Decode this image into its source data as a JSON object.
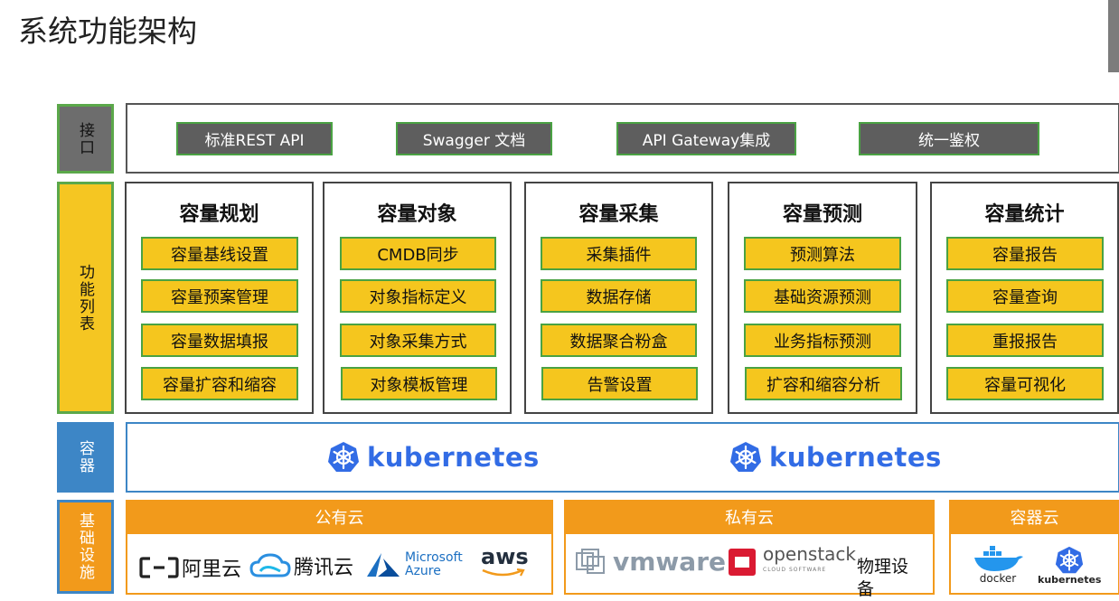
{
  "title": "系统功能架构",
  "rows": {
    "api": "接口",
    "functions": "功能列表",
    "container": "容器",
    "infra": "基础设施"
  },
  "api_buttons": [
    "标准REST API",
    "Swagger 文档",
    "API Gateway集成",
    "统一鉴权"
  ],
  "columns": [
    {
      "title": "容量规划",
      "items": [
        "容量基线设置",
        "容量预案管理",
        "容量数据填报",
        "容量扩容和缩容"
      ]
    },
    {
      "title": "容量对象",
      "items": [
        "CMDB同步",
        "对象指标定义",
        "对象采集方式",
        "对象模板管理"
      ]
    },
    {
      "title": "容量采集",
      "items": [
        "采集插件",
        "数据存储",
        "数据聚合粉盒",
        "告警设置"
      ]
    },
    {
      "title": "容量预测",
      "items": [
        "预测算法",
        "基础资源预测",
        "业务指标预测",
        "扩容和缩容分析"
      ]
    },
    {
      "title": "容量统计",
      "items": [
        "容量报告",
        "容量查询",
        "重报报告",
        "容量可视化"
      ]
    }
  ],
  "container": {
    "logo_text_1": "kubernetes",
    "logo_text_2": "kubernetes"
  },
  "clouds": {
    "public": {
      "label": "公有云",
      "logos": [
        "阿里云",
        "腾讯云",
        "Microsoft",
        "Azure",
        "aws"
      ]
    },
    "private": {
      "label": "私有云",
      "logos": [
        "vmware",
        "openstack",
        "CLOUD SOFTWARE",
        "物理设备"
      ]
    },
    "container": {
      "label": "容器云",
      "logos": [
        "docker",
        "kubernetes"
      ]
    }
  },
  "colors": {
    "gray": "#5e5e5e",
    "yellow": "#f5c61e",
    "green_border": "#4aa243",
    "blue": "#3d86c6",
    "orange": "#f29a1b",
    "k8s": "#326ce5"
  }
}
